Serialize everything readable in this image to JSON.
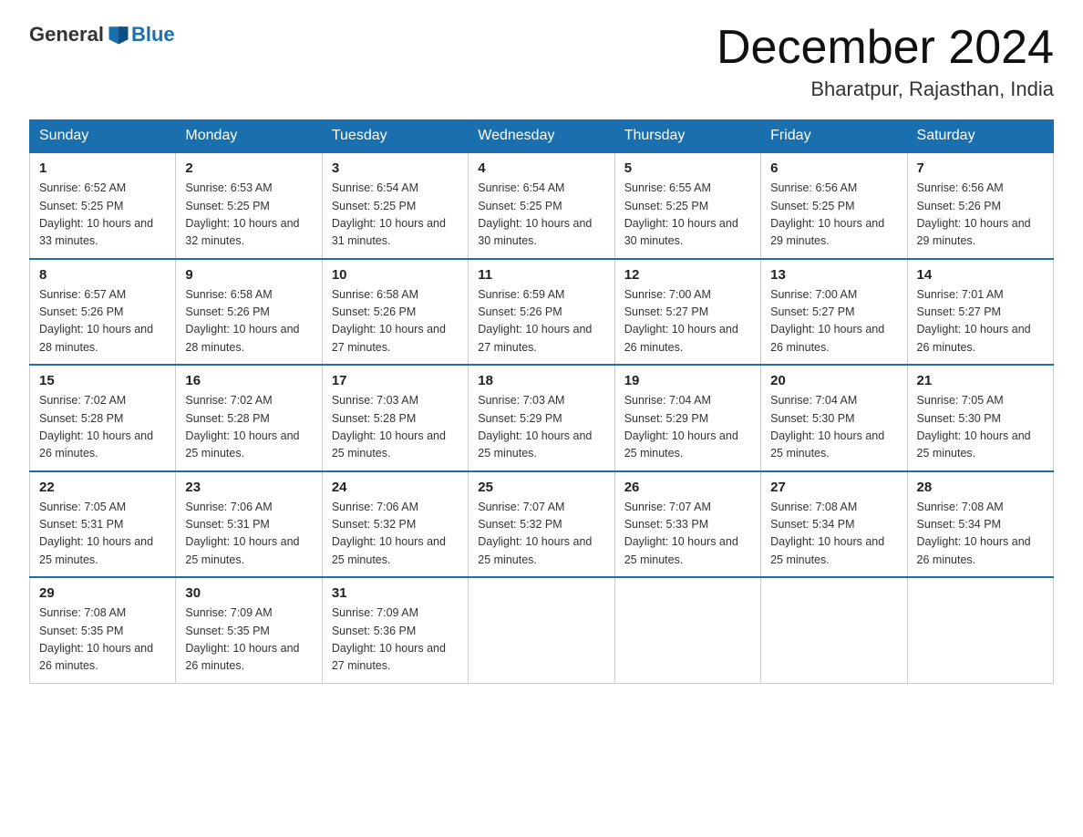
{
  "header": {
    "logo_general": "General",
    "logo_blue": "Blue",
    "title": "December 2024",
    "subtitle": "Bharatpur, Rajasthan, India"
  },
  "days_of_week": [
    "Sunday",
    "Monday",
    "Tuesday",
    "Wednesday",
    "Thursday",
    "Friday",
    "Saturday"
  ],
  "weeks": [
    [
      {
        "day": "1",
        "sunrise": "6:52 AM",
        "sunset": "5:25 PM",
        "daylight": "10 hours and 33 minutes."
      },
      {
        "day": "2",
        "sunrise": "6:53 AM",
        "sunset": "5:25 PM",
        "daylight": "10 hours and 32 minutes."
      },
      {
        "day": "3",
        "sunrise": "6:54 AM",
        "sunset": "5:25 PM",
        "daylight": "10 hours and 31 minutes."
      },
      {
        "day": "4",
        "sunrise": "6:54 AM",
        "sunset": "5:25 PM",
        "daylight": "10 hours and 30 minutes."
      },
      {
        "day": "5",
        "sunrise": "6:55 AM",
        "sunset": "5:25 PM",
        "daylight": "10 hours and 30 minutes."
      },
      {
        "day": "6",
        "sunrise": "6:56 AM",
        "sunset": "5:25 PM",
        "daylight": "10 hours and 29 minutes."
      },
      {
        "day": "7",
        "sunrise": "6:56 AM",
        "sunset": "5:26 PM",
        "daylight": "10 hours and 29 minutes."
      }
    ],
    [
      {
        "day": "8",
        "sunrise": "6:57 AM",
        "sunset": "5:26 PM",
        "daylight": "10 hours and 28 minutes."
      },
      {
        "day": "9",
        "sunrise": "6:58 AM",
        "sunset": "5:26 PM",
        "daylight": "10 hours and 28 minutes."
      },
      {
        "day": "10",
        "sunrise": "6:58 AM",
        "sunset": "5:26 PM",
        "daylight": "10 hours and 27 minutes."
      },
      {
        "day": "11",
        "sunrise": "6:59 AM",
        "sunset": "5:26 PM",
        "daylight": "10 hours and 27 minutes."
      },
      {
        "day": "12",
        "sunrise": "7:00 AM",
        "sunset": "5:27 PM",
        "daylight": "10 hours and 26 minutes."
      },
      {
        "day": "13",
        "sunrise": "7:00 AM",
        "sunset": "5:27 PM",
        "daylight": "10 hours and 26 minutes."
      },
      {
        "day": "14",
        "sunrise": "7:01 AM",
        "sunset": "5:27 PM",
        "daylight": "10 hours and 26 minutes."
      }
    ],
    [
      {
        "day": "15",
        "sunrise": "7:02 AM",
        "sunset": "5:28 PM",
        "daylight": "10 hours and 26 minutes."
      },
      {
        "day": "16",
        "sunrise": "7:02 AM",
        "sunset": "5:28 PM",
        "daylight": "10 hours and 25 minutes."
      },
      {
        "day": "17",
        "sunrise": "7:03 AM",
        "sunset": "5:28 PM",
        "daylight": "10 hours and 25 minutes."
      },
      {
        "day": "18",
        "sunrise": "7:03 AM",
        "sunset": "5:29 PM",
        "daylight": "10 hours and 25 minutes."
      },
      {
        "day": "19",
        "sunrise": "7:04 AM",
        "sunset": "5:29 PM",
        "daylight": "10 hours and 25 minutes."
      },
      {
        "day": "20",
        "sunrise": "7:04 AM",
        "sunset": "5:30 PM",
        "daylight": "10 hours and 25 minutes."
      },
      {
        "day": "21",
        "sunrise": "7:05 AM",
        "sunset": "5:30 PM",
        "daylight": "10 hours and 25 minutes."
      }
    ],
    [
      {
        "day": "22",
        "sunrise": "7:05 AM",
        "sunset": "5:31 PM",
        "daylight": "10 hours and 25 minutes."
      },
      {
        "day": "23",
        "sunrise": "7:06 AM",
        "sunset": "5:31 PM",
        "daylight": "10 hours and 25 minutes."
      },
      {
        "day": "24",
        "sunrise": "7:06 AM",
        "sunset": "5:32 PM",
        "daylight": "10 hours and 25 minutes."
      },
      {
        "day": "25",
        "sunrise": "7:07 AM",
        "sunset": "5:32 PM",
        "daylight": "10 hours and 25 minutes."
      },
      {
        "day": "26",
        "sunrise": "7:07 AM",
        "sunset": "5:33 PM",
        "daylight": "10 hours and 25 minutes."
      },
      {
        "day": "27",
        "sunrise": "7:08 AM",
        "sunset": "5:34 PM",
        "daylight": "10 hours and 25 minutes."
      },
      {
        "day": "28",
        "sunrise": "7:08 AM",
        "sunset": "5:34 PM",
        "daylight": "10 hours and 26 minutes."
      }
    ],
    [
      {
        "day": "29",
        "sunrise": "7:08 AM",
        "sunset": "5:35 PM",
        "daylight": "10 hours and 26 minutes."
      },
      {
        "day": "30",
        "sunrise": "7:09 AM",
        "sunset": "5:35 PM",
        "daylight": "10 hours and 26 minutes."
      },
      {
        "day": "31",
        "sunrise": "7:09 AM",
        "sunset": "5:36 PM",
        "daylight": "10 hours and 27 minutes."
      },
      null,
      null,
      null,
      null
    ]
  ],
  "labels": {
    "sunrise": "Sunrise:",
    "sunset": "Sunset:",
    "daylight": "Daylight:"
  }
}
